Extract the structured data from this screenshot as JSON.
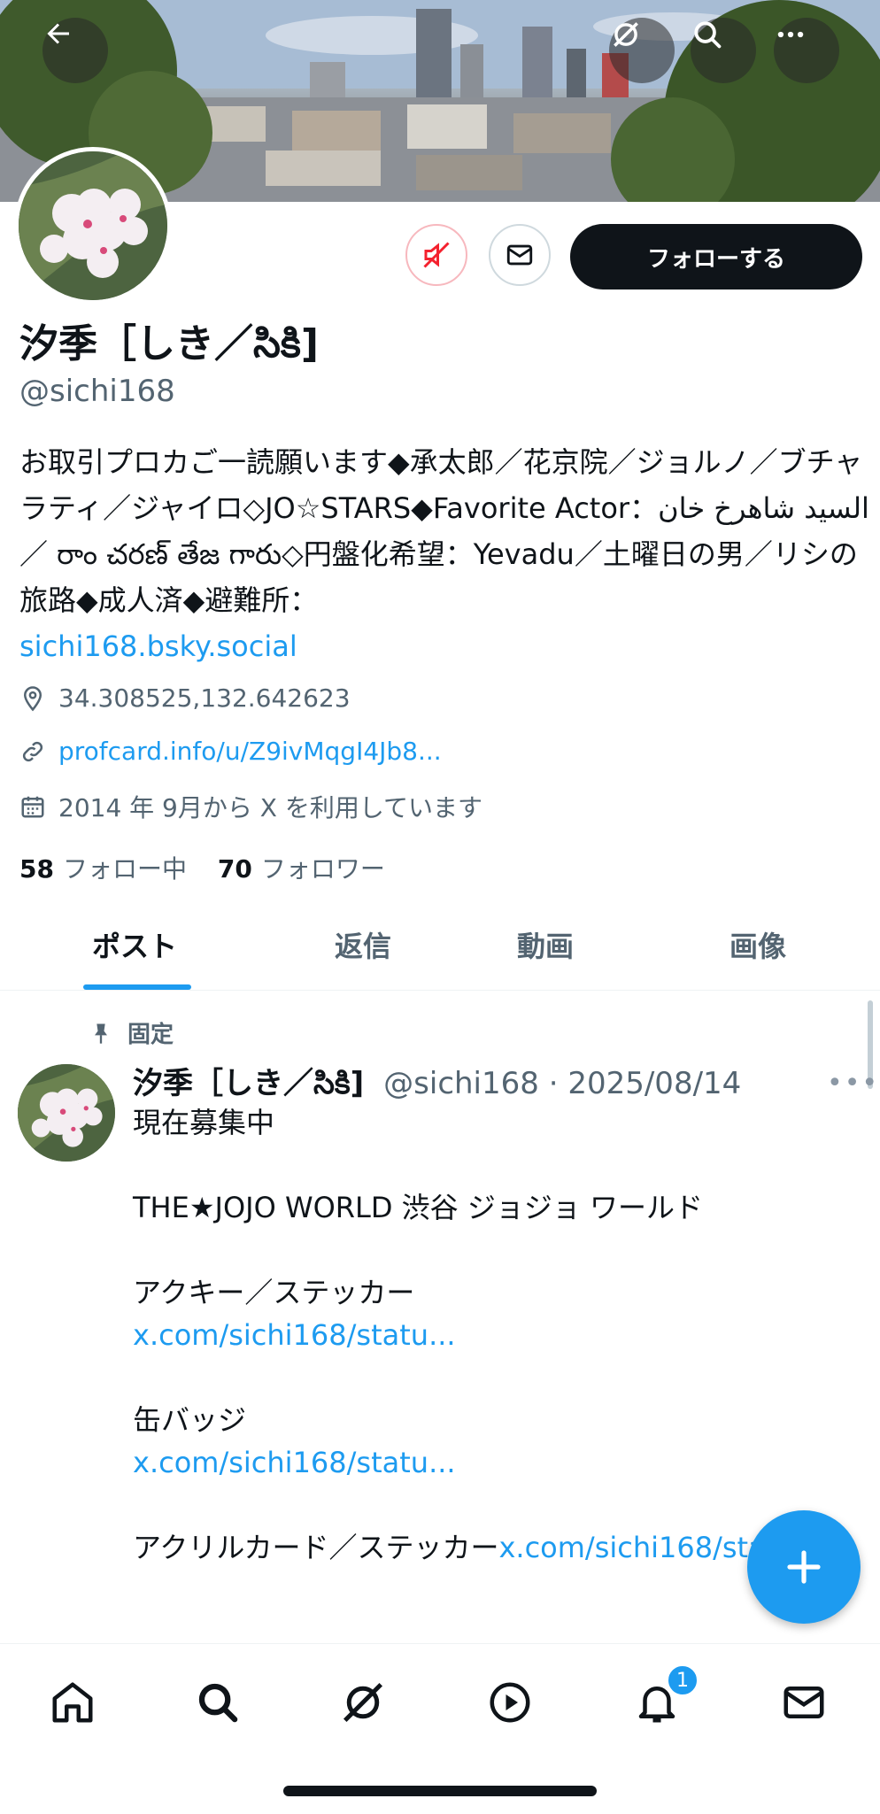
{
  "header": {
    "back_icon": "arrow-left-icon",
    "grok_icon": "grok-icon",
    "search_icon": "search-icon",
    "more_icon": "more-horizontal-icon"
  },
  "profile": {
    "name": "汐季［しき／సికి]",
    "handle": "@sichi168",
    "follow_label": "フォローする",
    "bio_text": "お取引プロカご一読願います◆承太郎／花京院／ジョルノ／ブチャラティ／ジャイロ◇JO☆STARS◆Favorite Actor：السيد شاهرخ خان ／ రాం చరణ్ తేజ గారు◇円盤化希望：Yevadu／土曜日の男／リシの旅路◆成人済◆避難所：",
    "bio_link": "sichi168.bsky.social",
    "location": "34.308525,132.642623",
    "website": "profcard.info/u/Z9ivMqgI4Jb8...",
    "joined": "2014 年 9月から X を利用しています",
    "following_count": "58",
    "following_label": "フォロー中",
    "followers_count": "70",
    "followers_label": "フォロワー"
  },
  "tabs": [
    "ポスト",
    "返信",
    "動画",
    "画像"
  ],
  "active_tab": 0,
  "post": {
    "pinned_label": "固定",
    "author_name": "汐季［しき／సికి]",
    "author_meta": "@sichi168 · 2025/08/14",
    "line1": "現在募集中",
    "line2": "THE★JOJO WORLD 渋谷 ジョジョ ワールド",
    "line3": "アクキー／ステッカー",
    "link1": "x.com/sichi168/statu...",
    "line4": "缶バッジ",
    "link2": "x.com/sichi168/statu...",
    "line5": "アクリルカード／ステッカー",
    "link3": "x.com/sichi168/statu..."
  },
  "bottom_nav": {
    "items": [
      "home-icon",
      "search-icon",
      "grok-icon",
      "video-icon",
      "notifications-icon",
      "messages-icon"
    ],
    "notification_badge": "1"
  },
  "colors": {
    "accent": "#1d9bf0",
    "text": "#0f1419",
    "secondary": "#536471",
    "mute_red": "#f4212e"
  }
}
